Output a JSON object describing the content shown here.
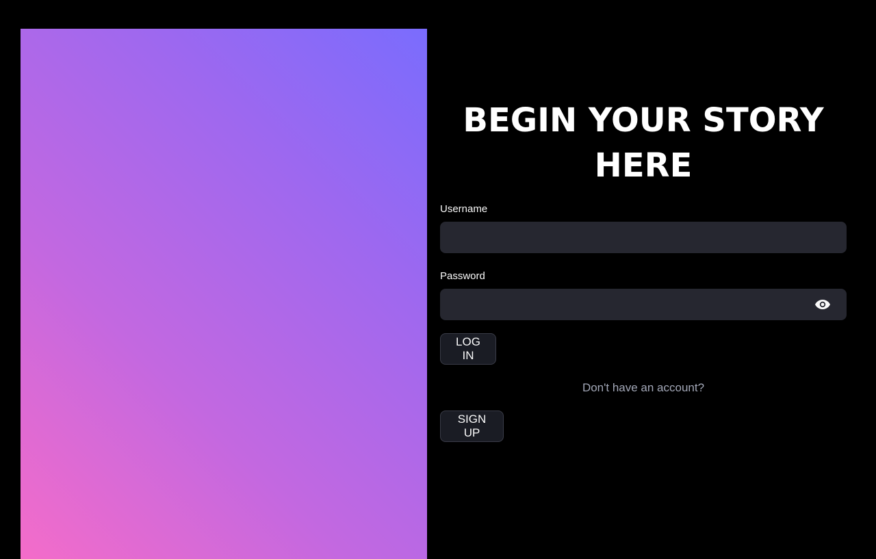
{
  "login_form": {
    "title": "BEGIN YOUR STORY HERE",
    "username_label": "Username",
    "username_value": "",
    "password_label": "Password",
    "password_value": "",
    "login_button": "LOG IN",
    "no_account_text": "Don't have an account?",
    "signup_button": "SIGN UP",
    "password_toggle_icon": "eye-icon"
  },
  "theme": {
    "background": "#000000",
    "input_background": "#262730",
    "button_background": "#1a1c24",
    "muted_text": "#a3a8b8",
    "gradient_start": "#f46cc9",
    "gradient_end": "#7a6cfd"
  }
}
